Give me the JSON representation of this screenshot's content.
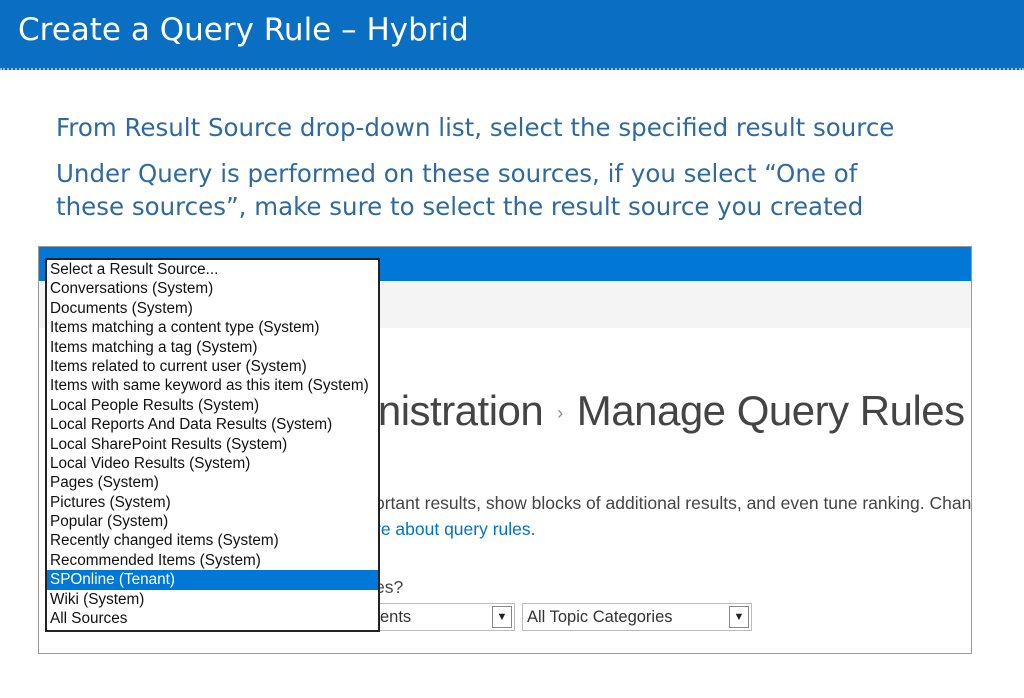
{
  "slide": {
    "title": "Create a Query Rule – Hybrid",
    "bullets": [
      "From Result Source drop-down list, select the specified result source",
      "Under Query is performed on these sources, if you select “One of",
      "these sources”, make sure to select the result source you created"
    ]
  },
  "screenshot": {
    "heading_part1": "inistration",
    "heading_sep": "›",
    "heading_part2": "Manage Query Rules",
    "description": "ortant results, show blocks of additional results, and even tune ranking. Changes r",
    "learn_link": "re about query rules",
    "learn_suffix": ".",
    "question": "es?",
    "select1_value": "ents",
    "select2_value": "All Topic Categories",
    "dropdown": {
      "options": [
        "Select a Result Source...",
        "Conversations (System)",
        "Documents (System)",
        "Items matching a content type (System)",
        "Items matching a tag (System)",
        "Items related to current user (System)",
        "Items with same keyword as this item (System)",
        "Local People Results (System)",
        "Local Reports And Data Results (System)",
        "Local SharePoint Results (System)",
        "Local Video Results (System)",
        "Pages (System)",
        "Pictures (System)",
        "Popular (System)",
        "Recently changed items (System)",
        "Recommended Items (System)",
        "SPOnline (Tenant)",
        "Wiki (System)",
        "All Sources"
      ],
      "selected_index": 16
    },
    "colors": {
      "title_bar": "#0a6fc2",
      "suite_bar": "#0078d7",
      "selected_option": "#0078d7"
    }
  }
}
